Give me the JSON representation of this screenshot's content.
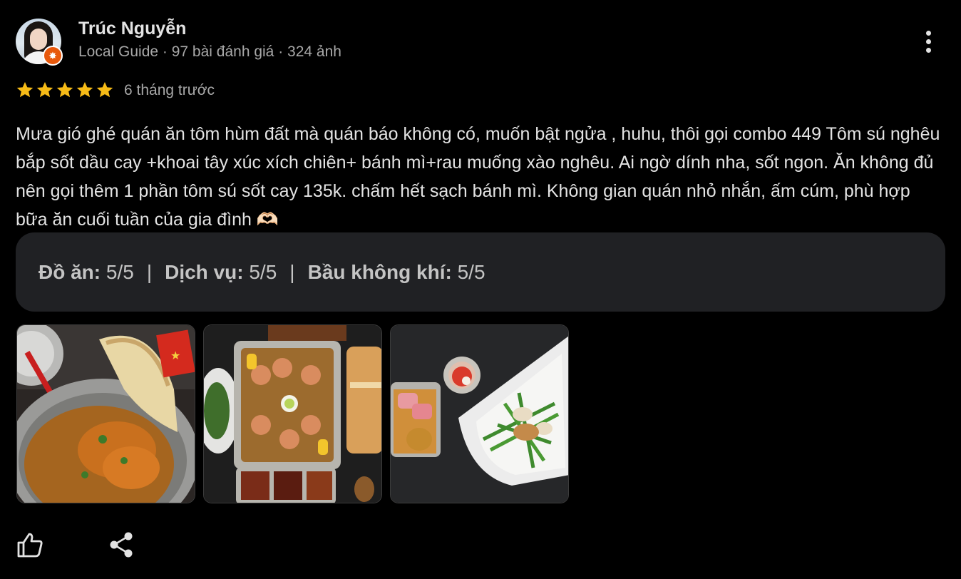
{
  "author": {
    "name": "Trúc Nguyễn",
    "meta": "Local Guide · 97 bài đánh giá · 324 ảnh",
    "badge_icon": "local-guide-star-icon"
  },
  "rating": {
    "stars": 5,
    "max_stars": 5,
    "time_ago": "6 tháng trước",
    "star_color": "#f6bb17"
  },
  "review_text": "Mưa gió ghé quán ăn tôm hùm đất mà quán báo không có, muốn bật ngửa , huhu, thôi gọi combo 449 Tôm sú nghêu bắp sốt dầu cay +khoai tây xúc xích chiên+ bánh mì+rau muống xào nghêu. Ai ngờ dính nha, sốt ngon. Ăn không đủ nên gọi thêm 1 phần tôm sú sốt cay 135k. chấm hết sạch bánh mì. Không gian quán nhỏ nhắn, ấm cúm, phù hợp bữa ăn cuối tuần của gia đình 🫶🏻",
  "sub_ratings": [
    {
      "label": "Đồ ăn:",
      "value": "5/5"
    },
    {
      "label": "Dịch vụ:",
      "value": "5/5"
    },
    {
      "label": "Bầu không khí:",
      "value": "5/5"
    }
  ],
  "photos": [
    {
      "icon": "food-photo-shrimp-bread"
    },
    {
      "icon": "food-photo-shrimp-clam-tray"
    },
    {
      "icon": "food-photo-morning-glory-clams"
    }
  ],
  "actions": {
    "like_icon": "thumbs-up-icon",
    "share_icon": "share-icon",
    "more_icon": "more-vert-icon"
  }
}
